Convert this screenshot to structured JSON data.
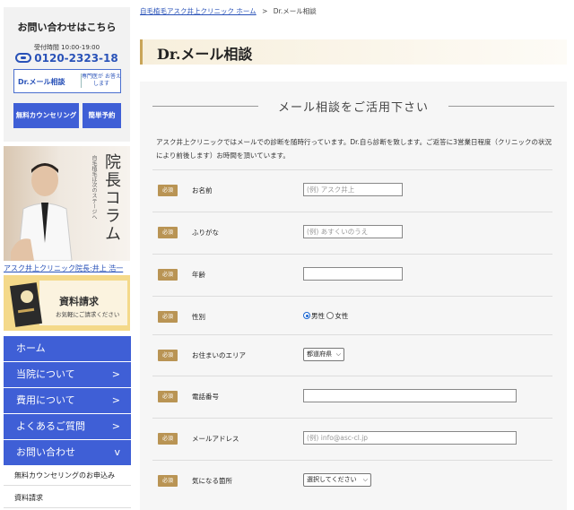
{
  "sidebar": {
    "contact_title": "お問い合わせはこちら",
    "hours": "受付時間 10:00-19:00",
    "phone": "0120-2323-18",
    "drmail_label": "Dr.メール相談",
    "drmail_sub": "専門医が お答えします",
    "counseling_btn": "無料カウンセリング",
    "reserve_btn": "簡単予約",
    "column_title": "院長コラム",
    "column_sub": "自毛植毛は次のステージへ",
    "doctor_link": "アスク井上クリニック院長:井上 浩一",
    "doc_request_title": "資料請求",
    "doc_request_sub": "お気軽にご請求ください",
    "nav": [
      {
        "label": "ホーム",
        "arrow": ""
      },
      {
        "label": "当院について",
        "arrow": ">"
      },
      {
        "label": "費用について",
        "arrow": ">"
      },
      {
        "label": "よくあるご質問",
        "arrow": ">"
      },
      {
        "label": "お問い合わせ",
        "arrow": "v"
      }
    ],
    "subnav": [
      "無料カウンセリングのお申込み",
      "資料請求"
    ]
  },
  "breadcrumb": {
    "home": "自毛植毛アスク井上クリニック ホーム",
    "sep": ">",
    "current": "Dr.メール相談"
  },
  "page_title": "Dr.メール相談",
  "section_title": "メール相談をご活用下さい",
  "intro": "アスク井上クリニックではメールでの診断を随時行っています。Dr.自ら診断を致します。ご返答に3営業日程度（クリニックの状況により前後します）お時間を頂いています。",
  "form": {
    "required_label": "必須",
    "rows": [
      {
        "label": "お名前",
        "placeholder": "(例) アスク井上"
      },
      {
        "label": "ふりがな",
        "placeholder": "(例) あすくいのうえ"
      },
      {
        "label": "年齢",
        "placeholder": ""
      },
      {
        "label": "性別",
        "options": [
          "男性",
          "女性"
        ],
        "selected": "男性"
      },
      {
        "label": "お住まいのエリア",
        "select_value": "都道府県"
      },
      {
        "label": "電話番号",
        "placeholder": ""
      },
      {
        "label": "メールアドレス",
        "placeholder": "(例) info@asc-cl.jp"
      },
      {
        "label": "気になる箇所",
        "select_value": "選択してください"
      }
    ]
  },
  "colors": {
    "nav_blue": "#3f5fd6",
    "gold": "#b99454",
    "link": "#2952b8"
  }
}
